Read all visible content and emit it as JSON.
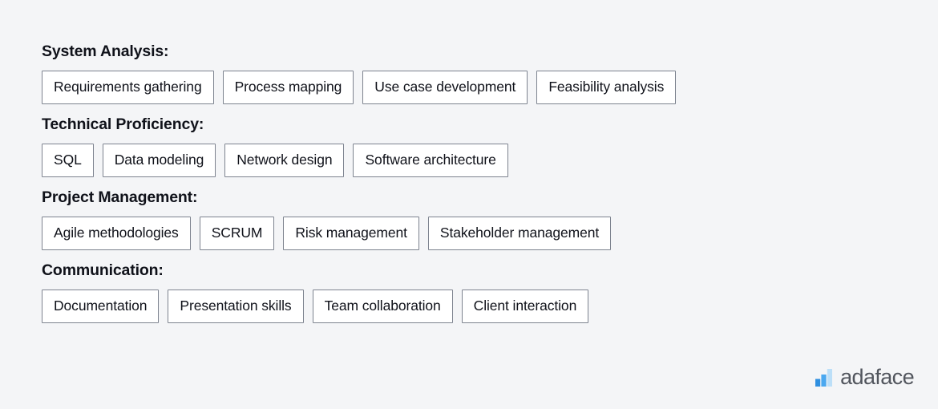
{
  "page": {
    "background_color": "#f4f5f7",
    "text_color": "#10121a",
    "tag_border_color": "#7d838f",
    "tag_background_color": "#ffffff"
  },
  "skill_groups": [
    {
      "heading": "System Analysis:",
      "tags": [
        "Requirements gathering",
        "Process mapping",
        "Use case development",
        "Feasibility analysis"
      ]
    },
    {
      "heading": "Technical Proficiency:",
      "tags": [
        "SQL",
        "Data modeling",
        "Network design",
        "Software architecture"
      ]
    },
    {
      "heading": "Project Management:",
      "tags": [
        "Agile methodologies",
        "SCRUM",
        "Risk management",
        "Stakeholder management"
      ]
    },
    {
      "heading": "Communication:",
      "tags": [
        "Documentation",
        "Presentation skills",
        "Team collaboration",
        "Client interaction"
      ]
    }
  ],
  "brand": {
    "name": "adaface",
    "icon": "bar-chart-logo-icon",
    "bar_colors": {
      "small_dark": "#2f8fe0",
      "medium": "#4aa8f0",
      "large_light": "#bcdff8"
    },
    "name_color": "#52565e"
  }
}
